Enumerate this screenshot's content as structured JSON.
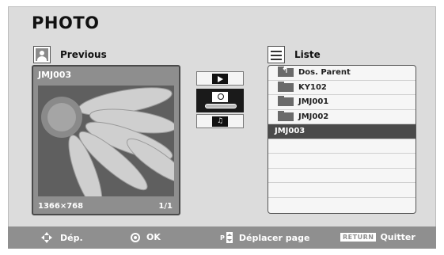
{
  "title": "PHOTO",
  "preview": {
    "header_label": "Previous",
    "filename": "JMJ003",
    "resolution": "1366×768",
    "page": "1/1"
  },
  "controls": [
    {
      "icon": "play-icon"
    },
    {
      "icon": "slideshow-timer-icon"
    },
    {
      "icon": "music-icon"
    }
  ],
  "list": {
    "header_label": "Liste",
    "items": [
      {
        "label": "Dos. Parent",
        "icon": "parent-folder-icon"
      },
      {
        "label": "KY102",
        "icon": "folder-icon"
      },
      {
        "label": "JMJ001",
        "icon": "folder-icon"
      },
      {
        "label": "JMJ002",
        "icon": "folder-icon"
      },
      {
        "label": "JMJ003",
        "selected": true
      },
      {
        "label": ""
      },
      {
        "label": ""
      },
      {
        "label": ""
      },
      {
        "label": ""
      }
    ]
  },
  "footer": {
    "move_label": "Dép.",
    "ok_label": "OK",
    "p_label": "P",
    "page_label": "Déplacer page",
    "return_key": "RETURN",
    "quit_label": "Quitter"
  },
  "colors": {
    "background": "#dcdcdc",
    "footer": "#8f8f8f",
    "selected_row": "#4a4a4a",
    "preview_bg": "#8e8e8e"
  }
}
